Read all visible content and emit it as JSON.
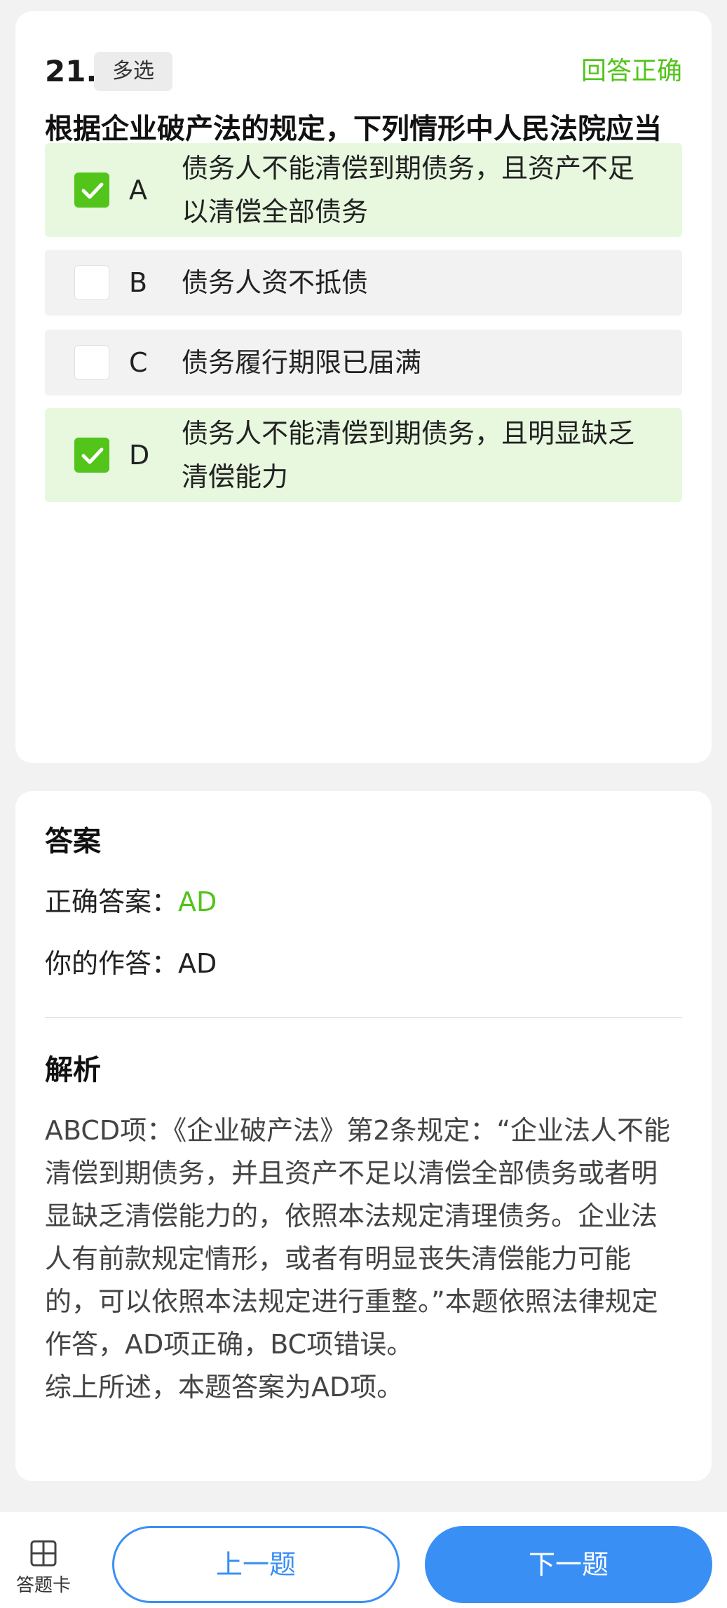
{
  "question": {
    "number": "21.",
    "type": "多选",
    "status": "回答正确",
    "text": "根据企业破产法的规定，下列情形中人民法院应当认定具备破产原因的是（）",
    "options": [
      {
        "letter": "A",
        "text": "债务人不能清偿到期债务，且资产不足以清偿全部债务",
        "selected": true
      },
      {
        "letter": "B",
        "text": "债务人资不抵债",
        "selected": false
      },
      {
        "letter": "C",
        "text": "债务履行期限已届满",
        "selected": false
      },
      {
        "letter": "D",
        "text": "债务人不能清偿到期债务，且明显缺乏清偿能力",
        "selected": true
      }
    ]
  },
  "answer": {
    "title": "答案",
    "correct_label": "正确答案：",
    "correct_value": "AD",
    "yours_label": "你的作答：",
    "yours_value": "AD"
  },
  "analysis": {
    "title": "解析",
    "paragraph1": "ABCD项：《企业破产法》第2条规定：“企业法人不能清偿到期债务，并且资产不足以清偿全部债务或者明显缺乏清偿能力的，依照本法规定清理债务。企业法人有前款规定情形，或者有明显丧失清偿能力可能的，可以依照本法规定进行重整。”本题依照法律规定作答，AD项正确，BC项错误。",
    "paragraph2": "综上所述，本题答案为AD项。"
  },
  "bottom_bar": {
    "card_label": "答题卡",
    "prev_label": "上一题",
    "next_label": "下一题"
  },
  "colors": {
    "accent_green": "#52c41a",
    "accent_blue": "#3a8ff5",
    "selected_bg": "#e7f8df"
  },
  "icons": {
    "check": "check-icon",
    "grid": "grid-icon"
  }
}
